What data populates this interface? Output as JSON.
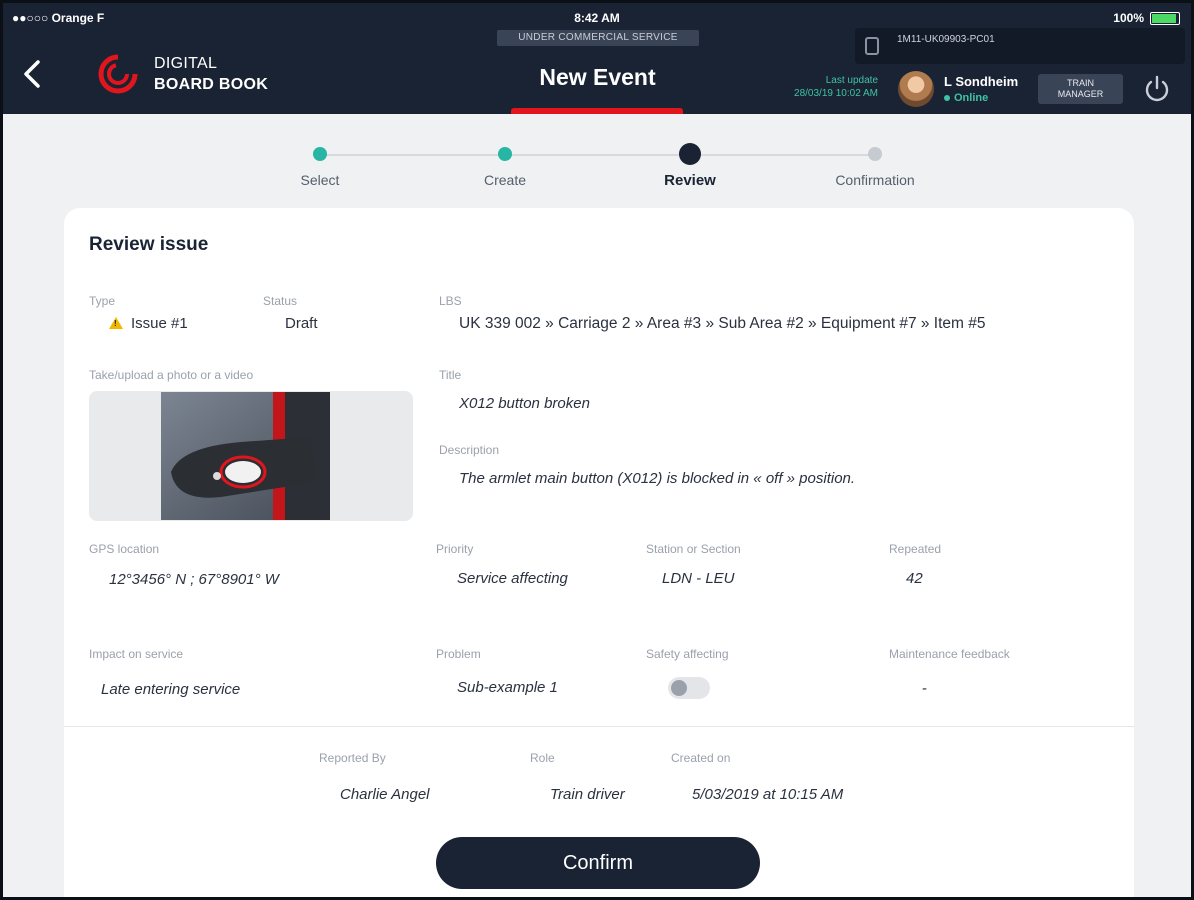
{
  "status_bar": {
    "carrier": "●●○○○ Orange F",
    "time": "8:42 AM",
    "battery": "100%"
  },
  "banner": "UNDER COMMERCIAL SERVICE",
  "header": {
    "brand_line1": "DIGITAL",
    "brand_line2": "BOARD BOOK",
    "title": "New Event",
    "device_id": "1M11-UK09903-PC01",
    "last_update_label": "Last update",
    "last_update_value": "28/03/19 10:02 AM",
    "user_name": "L Sondheim",
    "user_status": "Online",
    "role_line1": "TRAIN",
    "role_line2": "MANAGER"
  },
  "stepper": {
    "steps": [
      {
        "label": "Select",
        "state": "done"
      },
      {
        "label": "Create",
        "state": "done"
      },
      {
        "label": "Review",
        "state": "active"
      },
      {
        "label": "Confirmation",
        "state": "todo"
      }
    ]
  },
  "review": {
    "heading": "Review issue",
    "type_label": "Type",
    "type_value": "Issue #1",
    "status_label": "Status",
    "status_value": "Draft",
    "lbs_label": "LBS",
    "lbs_value": "UK 339 002 » Carriage 2 » Area #3 » Sub Area #2 » Equipment #7 » Item #5",
    "photo_label": "Take/upload a photo or a video",
    "title_label": "Title",
    "title_value": "X012 button broken",
    "description_label": "Description",
    "description_value": "The armlet main button (X012) is blocked in « off » position.",
    "gps_label": "GPS location",
    "gps_value": "12°3456° N ; 67°8901° W",
    "priority_label": "Priority",
    "priority_value": "Service affecting",
    "station_label": "Station or Section",
    "station_value": "LDN - LEU",
    "repeated_label": "Repeated",
    "repeated_value": "42",
    "impact_label": "Impact on service",
    "impact_value": "Late entering service",
    "problem_label": "Problem",
    "problem_value": "Sub-example 1",
    "safety_label": "Safety affecting",
    "safety_on": false,
    "maintenance_label": "Maintenance feedback",
    "maintenance_value": "-",
    "reported_by_label": "Reported By",
    "reported_by_value": "Charlie Angel",
    "role_label": "Role",
    "role_value": "Train driver",
    "created_label": "Created on",
    "created_value": "5/03/2019 at 10:15 AM"
  },
  "confirm_label": "Confirm",
  "colors": {
    "header_bg": "#1a2333",
    "accent_red": "#e1161c",
    "accent_teal": "#27b5a4"
  }
}
